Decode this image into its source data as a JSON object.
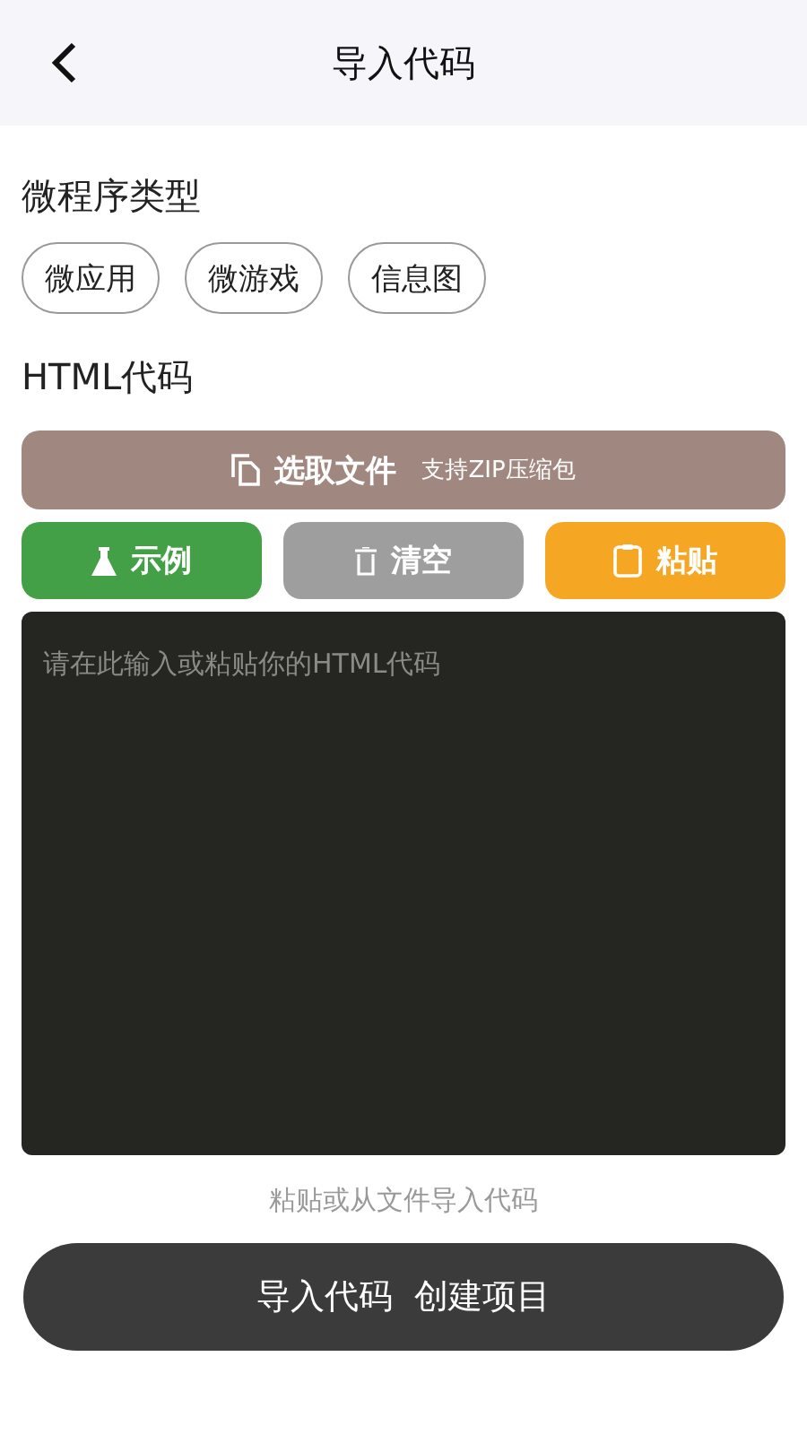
{
  "header": {
    "title": "导入代码"
  },
  "program_type": {
    "label": "微程序类型",
    "options": [
      {
        "label": "微应用"
      },
      {
        "label": "微游戏"
      },
      {
        "label": "信息图"
      }
    ]
  },
  "html_code": {
    "label": "HTML代码",
    "file_button": {
      "label": "选取文件",
      "hint": "支持ZIP压缩包"
    },
    "actions": [
      {
        "kind": "example",
        "label": "示例"
      },
      {
        "kind": "clear",
        "label": "清空"
      },
      {
        "kind": "paste",
        "label": "粘贴"
      }
    ],
    "editor": {
      "placeholder": "请在此输入或粘贴你的HTML代码"
    },
    "note": "粘贴或从文件导入代码"
  },
  "submit": {
    "label": "导入代码  创建项目"
  }
}
